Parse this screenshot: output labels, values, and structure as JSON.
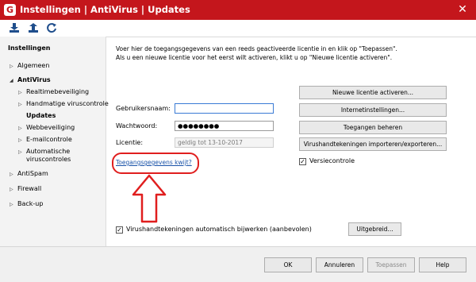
{
  "window": {
    "title": "Instellingen | AntiVirus | Updates",
    "logo_letter": "G",
    "close_glyph": "✕",
    "brand_color": "#c4161c"
  },
  "toolbar": {
    "icons": [
      "download-icon",
      "upload-icon",
      "reset-icon"
    ]
  },
  "sidebar": {
    "header": "Instellingen",
    "items": [
      {
        "label": "Algemeen",
        "arrow": "▷"
      },
      {
        "label": "AntiVirus",
        "arrow": "◢"
      },
      {
        "label": "Realtimebeveiliging",
        "arrow": "▷"
      },
      {
        "label": "Handmatige viruscontrole",
        "arrow": "▷"
      },
      {
        "label": "Updates",
        "arrow": ""
      },
      {
        "label": "Webbeveiliging",
        "arrow": "▷"
      },
      {
        "label": "E-mailcontrole",
        "arrow": "▷"
      },
      {
        "label": "Automatische",
        "arrow": "▷"
      },
      {
        "label": "viruscontroles",
        "arrow": ""
      },
      {
        "label": "AntiSpam",
        "arrow": "▷"
      },
      {
        "label": "Firewall",
        "arrow": "▷"
      },
      {
        "label": "Back-up",
        "arrow": "▷"
      }
    ]
  },
  "main": {
    "intro_line1": "Voer hier de toegangsgegevens van een reeds geactiveerde licentie in en klik op \"Toepassen\".",
    "intro_line2": "Als u een nieuwe licentie voor het eerst wilt activeren, klikt u op \"Nieuwe licentie activeren\".",
    "username_label": "Gebruikersnaam:",
    "username_value": "",
    "password_label": "Wachtwoord:",
    "password_value": "●●●●●●●●",
    "license_label": "Licentie:",
    "license_value": "geldig tot 13-10-2017",
    "forgot_link": "Toegangsgegevens kwijt?",
    "buttons": {
      "new_license": "Nieuwe licentie activeren...",
      "internet_settings": "Internetinstellingen...",
      "manage_access": "Toegangen beheren",
      "import_export": "Virushandtekeningen importeren/exporteren..."
    },
    "version_check_label": "Versiecontrole",
    "version_check_checked": true,
    "auto_update_label": "Virushandtekeningen automatisch bijwerken (aanbevolen)",
    "auto_update_checked": true,
    "advanced_button": "Uitgebreid...",
    "check_glyph": "✓"
  },
  "footer": {
    "ok": "OK",
    "cancel": "Annuleren",
    "apply": "Toepassen",
    "help": "Help"
  },
  "annotation": {
    "color": "#e01e1e"
  }
}
